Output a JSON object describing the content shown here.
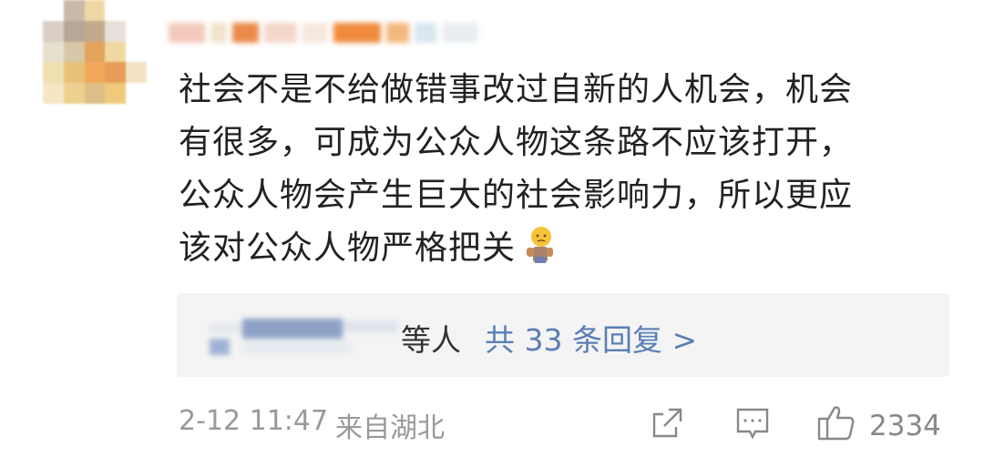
{
  "comment": {
    "lines": [
      "社会不是不给做错事改过自新的人机会，机会",
      "有很多，可成为公众人物这条路不应该打开，",
      "公众人物会产生巨大的社会影响力，所以更应",
      "该对公众人物严格把关"
    ],
    "emoji_icon": "shrug-emoji-icon"
  },
  "replies": {
    "suffix": "等人",
    "link_text": "共 33 条回复 >"
  },
  "footer": {
    "time": "2-12 11:47",
    "location": "来自湖北",
    "like_count": "2334"
  },
  "colors": {
    "link": "#5a7fb5",
    "meta": "#999999",
    "reply_bg": "#f4f4f4"
  },
  "icons": [
    "share-icon",
    "comment-icon",
    "like-icon"
  ]
}
